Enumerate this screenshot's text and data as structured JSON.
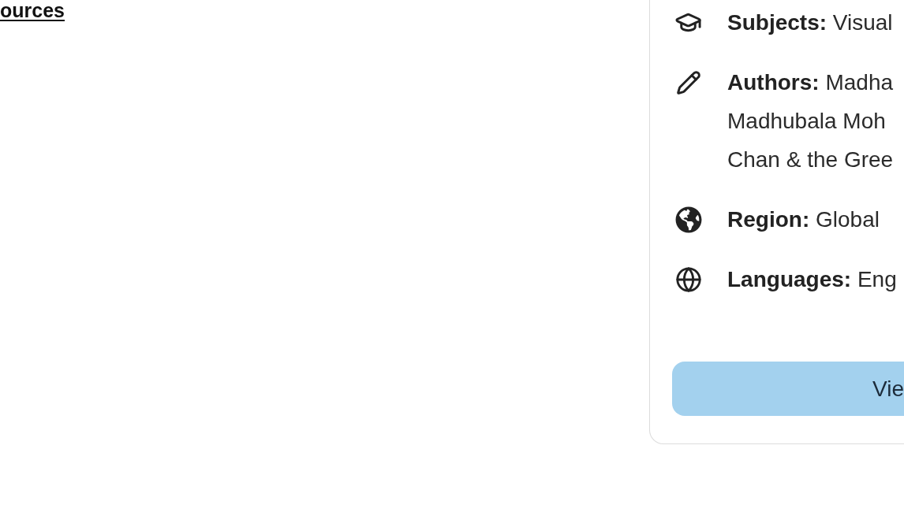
{
  "resources_link": {
    "label": "ources"
  },
  "details_card": {
    "items": [
      {
        "kind": "subjects",
        "label": "Subjects:",
        "lines": [
          "Visual"
        ]
      },
      {
        "kind": "authors",
        "label": "Authors:",
        "lines": [
          "Madha",
          "Madhubala Moh",
          "Chan & the Gree"
        ]
      },
      {
        "kind": "region",
        "label": "Region:",
        "lines": [
          "Global"
        ]
      },
      {
        "kind": "languages",
        "label": "Languages:",
        "lines": [
          "Eng"
        ]
      }
    ],
    "button": {
      "label": "Vie"
    }
  }
}
